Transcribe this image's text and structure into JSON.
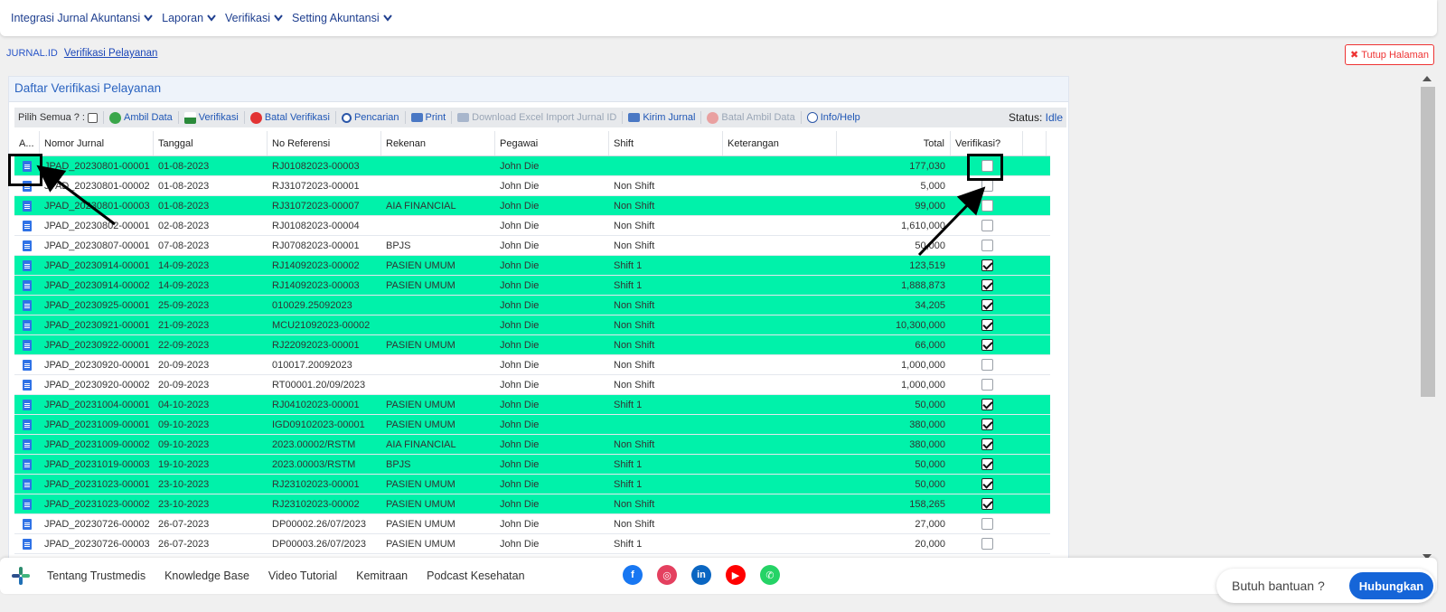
{
  "nav": {
    "items": [
      {
        "label": "Integrasi Jurnal Akuntansi"
      },
      {
        "label": "Laporan"
      },
      {
        "label": "Verifikasi"
      },
      {
        "label": "Setting Akuntansi"
      }
    ]
  },
  "breadcrumb": {
    "root": "JURNAL.ID",
    "current": "Verifikasi Pelayanan"
  },
  "close_page": "Tutup Halaman",
  "panel": {
    "title": "Daftar Verifikasi Pelayanan"
  },
  "toolbar": {
    "select_all": "Pilih Semua ? :",
    "ambil_data": "Ambil Data",
    "verifikasi": "Verifikasi",
    "batal_verifikasi": "Batal Verifikasi",
    "pencarian": "Pencarian",
    "print": "Print",
    "download": "Download Excel Import Jurnal ID",
    "kirim_jurnal": "Kirim Jurnal",
    "batal_ambil": "Batal Ambil Data",
    "info": "Info/Help",
    "status_label": "Status:",
    "status_value": "Idle"
  },
  "grid": {
    "columns": [
      "A...",
      "Nomor Jurnal",
      "Tanggal",
      "No Referensi",
      "Rekenan",
      "Pegawai",
      "Shift",
      "Keterangan",
      "Total",
      "Verifikasi?"
    ],
    "rows": [
      {
        "nomor": "JPAD_20230801-00001",
        "tanggal": "01-08-2023",
        "ref": "RJ01082023-00003",
        "rekenan": "",
        "pegawai": "John Die",
        "shift": "",
        "ket": "",
        "total": "177,030",
        "verif": false,
        "hl": true
      },
      {
        "nomor": "JPAD_20230801-00002",
        "tanggal": "01-08-2023",
        "ref": "RJ31072023-00001",
        "rekenan": "",
        "pegawai": "John Die",
        "shift": "Non Shift",
        "ket": "",
        "total": "5,000",
        "verif": false,
        "hl": false
      },
      {
        "nomor": "JPAD_20230801-00003",
        "tanggal": "01-08-2023",
        "ref": "RJ31072023-00007",
        "rekenan": "AIA FINANCIAL",
        "pegawai": "John Die",
        "shift": "Non Shift",
        "ket": "",
        "total": "99,000",
        "verif": false,
        "hl": true
      },
      {
        "nomor": "JPAD_20230802-00001",
        "tanggal": "02-08-2023",
        "ref": "RJ01082023-00004",
        "rekenan": "",
        "pegawai": "John Die",
        "shift": "Non Shift",
        "ket": "",
        "total": "1,610,000",
        "verif": false,
        "hl": false
      },
      {
        "nomor": "JPAD_20230807-00001",
        "tanggal": "07-08-2023",
        "ref": "RJ07082023-00001",
        "rekenan": "BPJS",
        "pegawai": "John Die",
        "shift": "Non Shift",
        "ket": "",
        "total": "50,000",
        "verif": false,
        "hl": false
      },
      {
        "nomor": "JPAD_20230914-00001",
        "tanggal": "14-09-2023",
        "ref": "RJ14092023-00002",
        "rekenan": "PASIEN UMUM",
        "pegawai": "John Die",
        "shift": "Shift 1",
        "ket": "",
        "total": "123,519",
        "verif": true,
        "hl": true
      },
      {
        "nomor": "JPAD_20230914-00002",
        "tanggal": "14-09-2023",
        "ref": "RJ14092023-00003",
        "rekenan": "PASIEN UMUM",
        "pegawai": "John Die",
        "shift": "Shift 1",
        "ket": "",
        "total": "1,888,873",
        "verif": true,
        "hl": true
      },
      {
        "nomor": "JPAD_20230925-00001",
        "tanggal": "25-09-2023",
        "ref": "010029.25092023",
        "rekenan": "",
        "pegawai": "John Die",
        "shift": "Non Shift",
        "ket": "",
        "total": "34,205",
        "verif": true,
        "hl": true
      },
      {
        "nomor": "JPAD_20230921-00001",
        "tanggal": "21-09-2023",
        "ref": "MCU21092023-00002",
        "rekenan": "",
        "pegawai": "John Die",
        "shift": "Non Shift",
        "ket": "",
        "total": "10,300,000",
        "verif": true,
        "hl": true
      },
      {
        "nomor": "JPAD_20230922-00001",
        "tanggal": "22-09-2023",
        "ref": "RJ22092023-00001",
        "rekenan": "PASIEN UMUM",
        "pegawai": "John Die",
        "shift": "Non Shift",
        "ket": "",
        "total": "66,000",
        "verif": true,
        "hl": true
      },
      {
        "nomor": "JPAD_20230920-00001",
        "tanggal": "20-09-2023",
        "ref": "010017.20092023",
        "rekenan": "",
        "pegawai": "John Die",
        "shift": "Non Shift",
        "ket": "",
        "total": "1,000,000",
        "verif": false,
        "hl": false
      },
      {
        "nomor": "JPAD_20230920-00002",
        "tanggal": "20-09-2023",
        "ref": "RT00001.20/09/2023",
        "rekenan": "",
        "pegawai": "John Die",
        "shift": "Non Shift",
        "ket": "",
        "total": "1,000,000",
        "verif": false,
        "hl": false
      },
      {
        "nomor": "JPAD_20231004-00001",
        "tanggal": "04-10-2023",
        "ref": "RJ04102023-00001",
        "rekenan": "PASIEN UMUM",
        "pegawai": "John Die",
        "shift": "Shift 1",
        "ket": "",
        "total": "50,000",
        "verif": true,
        "hl": true
      },
      {
        "nomor": "JPAD_20231009-00001",
        "tanggal": "09-10-2023",
        "ref": "IGD09102023-00001",
        "rekenan": "PASIEN UMUM",
        "pegawai": "John Die",
        "shift": "",
        "ket": "",
        "total": "380,000",
        "verif": true,
        "hl": true
      },
      {
        "nomor": "JPAD_20231009-00002",
        "tanggal": "09-10-2023",
        "ref": "2023.00002/RSTM",
        "rekenan": "AIA FINANCIAL",
        "pegawai": "John Die",
        "shift": "Non Shift",
        "ket": "",
        "total": "380,000",
        "verif": true,
        "hl": true
      },
      {
        "nomor": "JPAD_20231019-00003",
        "tanggal": "19-10-2023",
        "ref": "2023.00003/RSTM",
        "rekenan": "BPJS",
        "pegawai": "John Die",
        "shift": "Shift 1",
        "ket": "",
        "total": "50,000",
        "verif": true,
        "hl": true
      },
      {
        "nomor": "JPAD_20231023-00001",
        "tanggal": "23-10-2023",
        "ref": "RJ23102023-00001",
        "rekenan": "PASIEN UMUM",
        "pegawai": "John Die",
        "shift": "Shift 1",
        "ket": "",
        "total": "50,000",
        "verif": true,
        "hl": true
      },
      {
        "nomor": "JPAD_20231023-00002",
        "tanggal": "23-10-2023",
        "ref": "RJ23102023-00002",
        "rekenan": "PASIEN UMUM",
        "pegawai": "John Die",
        "shift": "Non Shift",
        "ket": "",
        "total": "158,265",
        "verif": true,
        "hl": true
      },
      {
        "nomor": "JPAD_20230726-00002",
        "tanggal": "26-07-2023",
        "ref": "DP00002.26/07/2023",
        "rekenan": "PASIEN UMUM",
        "pegawai": "John Die",
        "shift": "Non Shift",
        "ket": "",
        "total": "27,000",
        "verif": false,
        "hl": false
      },
      {
        "nomor": "JPAD_20230726-00003",
        "tanggal": "26-07-2023",
        "ref": "DP00003.26/07/2023",
        "rekenan": "PASIEN UMUM",
        "pegawai": "John Die",
        "shift": "Shift 1",
        "ket": "",
        "total": "20,000",
        "verif": false,
        "hl": false
      }
    ]
  },
  "footer": {
    "links": [
      "Tentang Trustmedis",
      "Knowledge Base",
      "Video Tutorial",
      "Kemitraan",
      "Podcast Kesehatan"
    ],
    "socials": [
      {
        "name": "facebook-icon",
        "color": "#1877f2",
        "glyph": "f"
      },
      {
        "name": "instagram-icon",
        "color": "#e4405f",
        "glyph": "◎"
      },
      {
        "name": "linkedin-icon",
        "color": "#0a66c2",
        "glyph": "in"
      },
      {
        "name": "youtube-icon",
        "color": "#ff0000",
        "glyph": "▶"
      },
      {
        "name": "whatsapp-icon",
        "color": "#25d366",
        "glyph": "✆"
      }
    ]
  },
  "help": {
    "text": "Butuh bantuan ?",
    "button": "Hubungkan"
  }
}
